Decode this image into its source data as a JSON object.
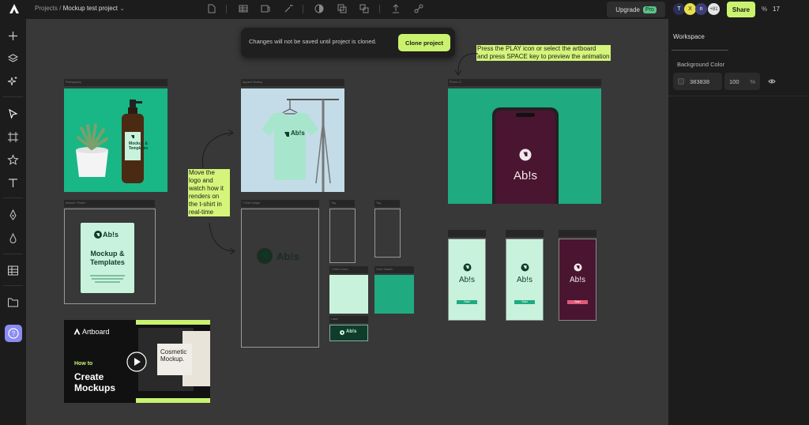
{
  "header": {
    "breadcrumb_root": "Projects",
    "breadcrumb_sep": " / ",
    "project_name": "Mockup test project",
    "upgrade_label": "Upgrade",
    "pro_badge": "Pro",
    "avatars": [
      "T",
      "X",
      "n",
      "+81"
    ],
    "share_label": "Share",
    "zoom_symbol": "%",
    "zoom_value": "17"
  },
  "toast": {
    "message": "Changes will not be saved until project is cloned.",
    "button_label": "Clone project"
  },
  "right_panel": {
    "tab": "Workspace",
    "section": "Background Color",
    "color_hex": "383838",
    "opacity": "100",
    "opacity_unit": "%"
  },
  "notes": {
    "preview_line1": "Press the PLAY icon or select the artboard",
    "preview_line2": "and press SPACE key to preview the animation",
    "move_lines": [
      "Move the",
      "logo and",
      "watch how it",
      "renders on",
      "the t-shirt in",
      "real-time"
    ]
  },
  "canvas": {
    "brand": "Ab!s",
    "poster_title_1": "Mockup &",
    "poster_title_2": "Templates",
    "bottle_label_1": "Mockup &",
    "bottle_label_2": "Templates",
    "phone_button": "Start",
    "video_brand": "Artboard",
    "video_how": "How to",
    "video_create": "Create",
    "video_mockups": "Mockups",
    "video_screen_1": "Cosmetic",
    "video_screen_2": "Mockup."
  },
  "colors": {
    "accent": "#c9f36e",
    "mint": "#c8f2dc",
    "green": "#18b785",
    "teal": "#1faa80",
    "maroon": "#4a1530",
    "dark_bg": "#1c1c1c",
    "canvas": "#383838"
  }
}
